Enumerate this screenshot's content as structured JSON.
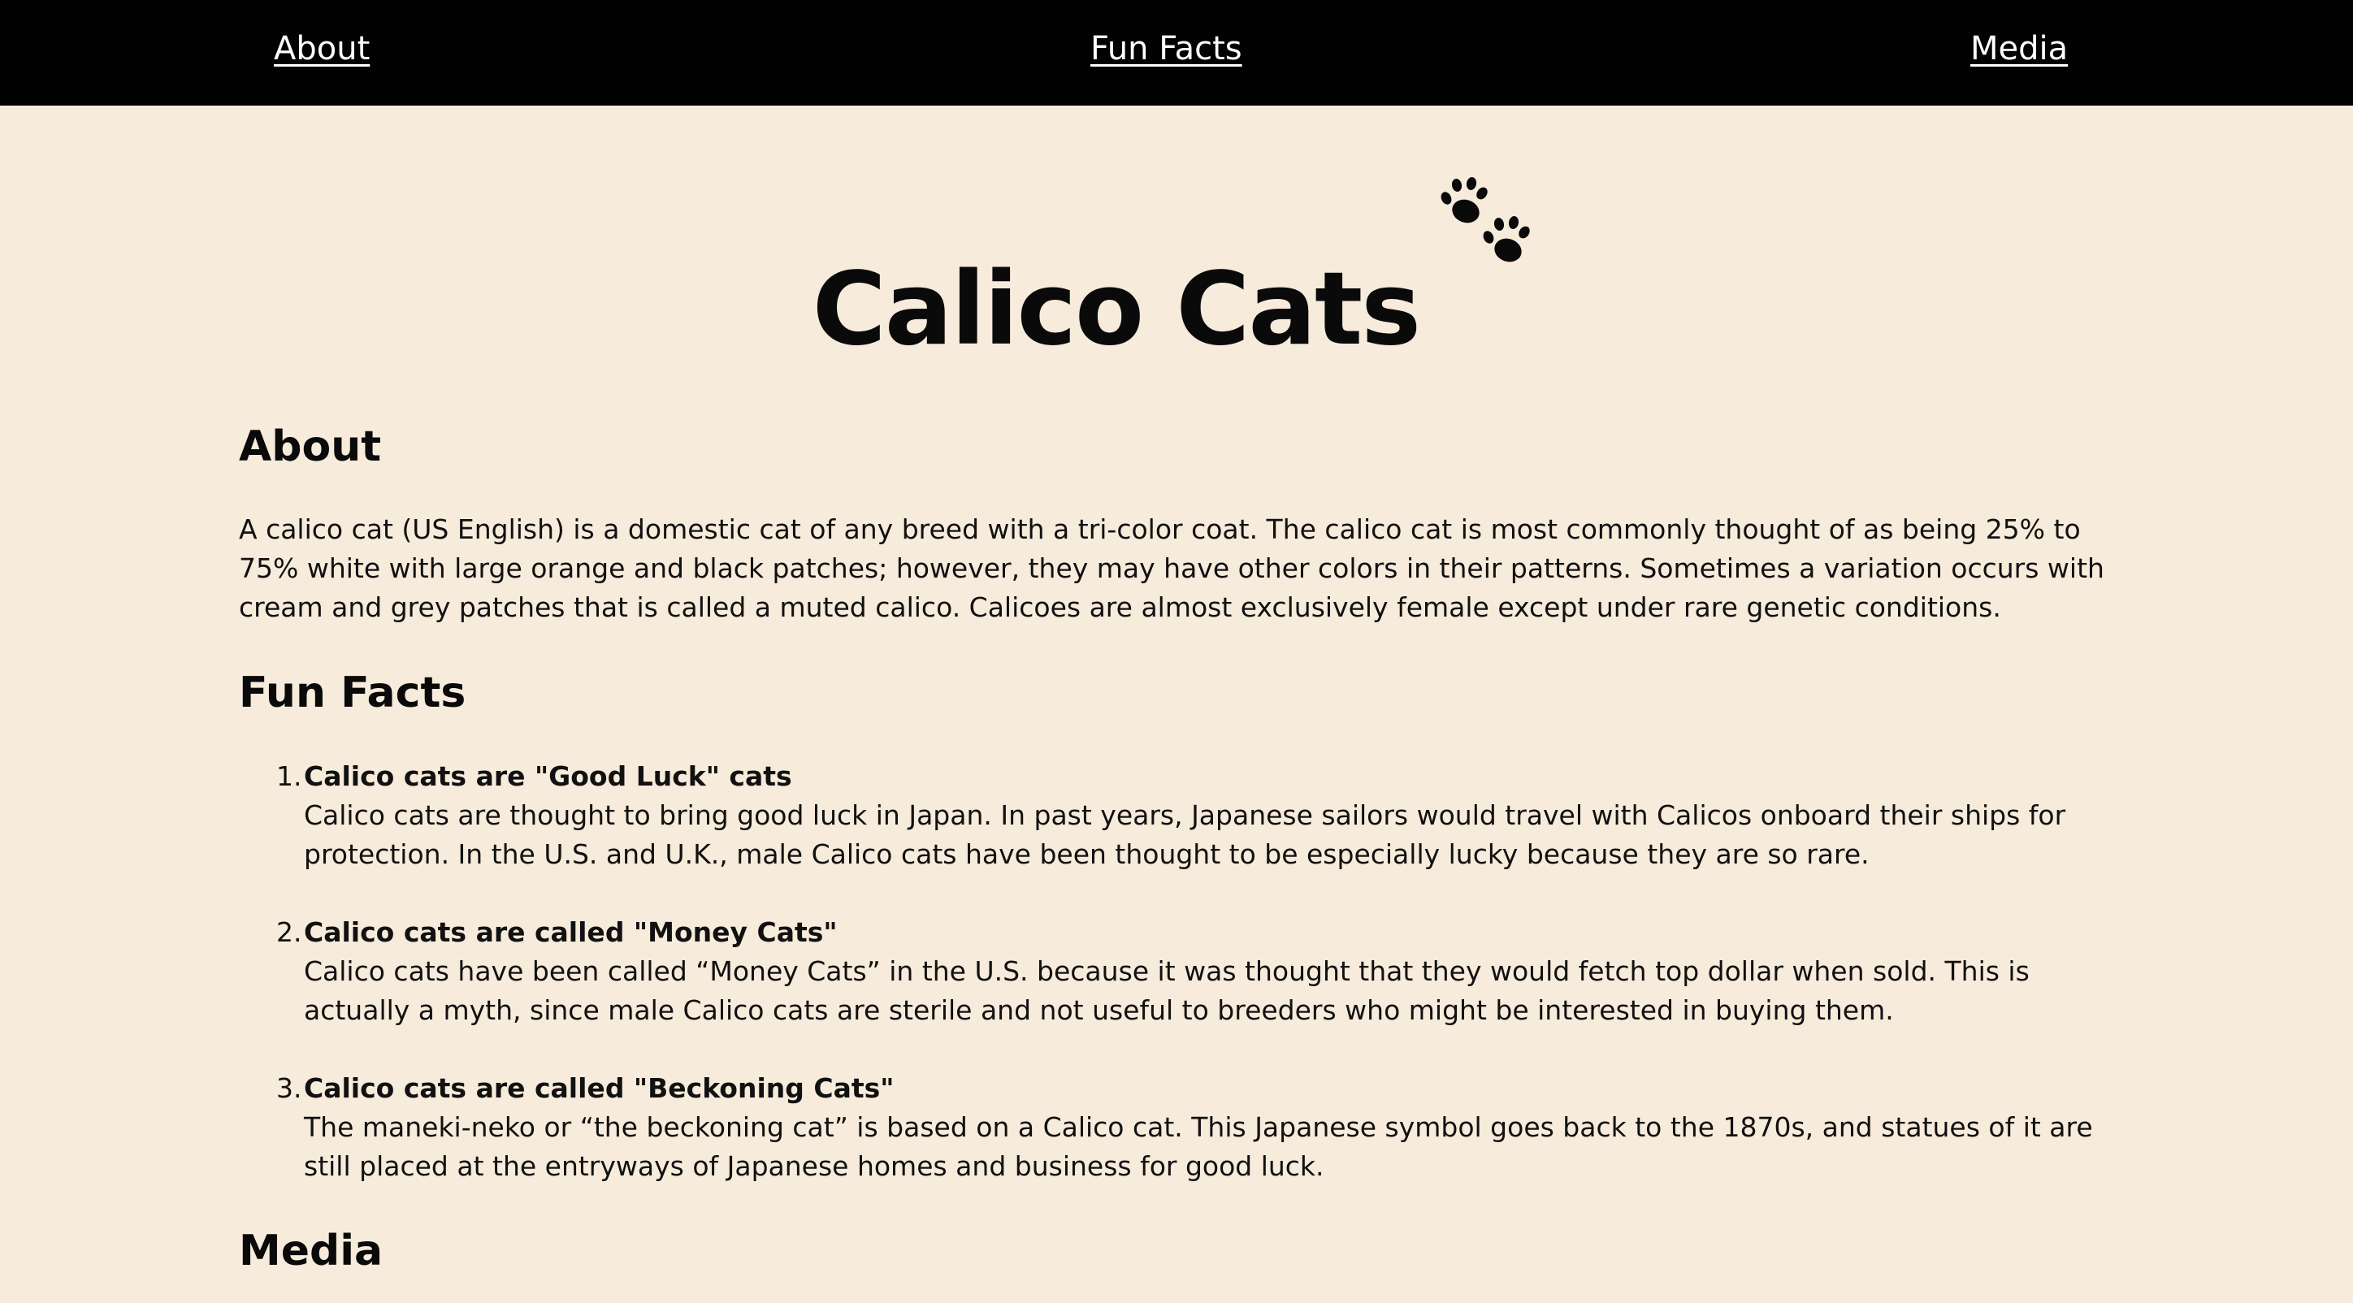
{
  "nav": {
    "about": "About",
    "fun_facts": "Fun Facts",
    "media": "Media"
  },
  "title": "Calico Cats",
  "title_icon": "paw-prints-icon",
  "about": {
    "heading": "About",
    "text": "A calico cat (US English) is a domestic cat of any breed with a tri-color coat. The calico cat is most commonly thought of as being 25% to 75% white with large orange and black patches; however, they may have other colors in their patterns. Sometimes a variation occurs with cream and grey patches that is called a muted calico. Calicoes are almost exclusively female except under rare genetic conditions."
  },
  "fun_facts": {
    "heading": "Fun Facts",
    "items": [
      {
        "number": "1.",
        "title": "Calico cats are \"Good Luck\" cats",
        "body": "Calico cats are thought to bring good luck in Japan. In past years, Japanese sailors would travel with Calicos onboard their ships for protection. In the U.S. and U.K., male Calico cats have been thought to be especially lucky because they are so rare."
      },
      {
        "number": "2.",
        "title": "Calico cats are called \"Money Cats\"",
        "body": "Calico cats have been called “Money Cats” in the U.S. because it was thought that they would fetch top dollar when sold. This is actually a myth, since male Calico cats are sterile and not useful to breeders who might be interested in buying them."
      },
      {
        "number": "3.",
        "title": "Calico cats are called \"Beckoning Cats\"",
        "body": "The maneki-neko or “the beckoning cat” is based on a Calico cat. This Japanese symbol goes back to the 1870s, and statues of it are still placed at the entryways of Japanese homes and business for good luck."
      }
    ]
  },
  "media": {
    "heading": "Media"
  },
  "colors": {
    "navbar_bg": "#020202",
    "nav_text": "#ffffff",
    "page_bg": "#f7ebdb",
    "text": "#111111"
  }
}
